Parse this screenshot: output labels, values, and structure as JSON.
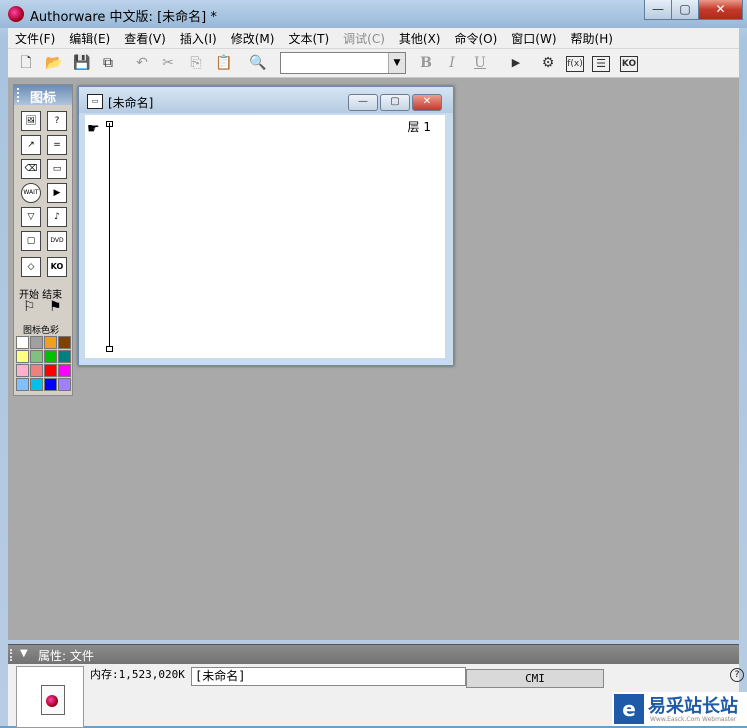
{
  "window": {
    "title": "Authorware 中文版: [未命名] *",
    "min": "—",
    "max": "▢",
    "close": "✕"
  },
  "menu": [
    "文件(F)",
    "编辑(E)",
    "查看(V)",
    "插入(I)",
    "修改(M)",
    "文本(T)",
    "调试(C)",
    "其他(X)",
    "命令(O)",
    "窗口(W)",
    "帮助(H)"
  ],
  "menu_disabled": [
    "调试(C)"
  ],
  "toolbar": {
    "new": "🗋",
    "open": "📂",
    "save_all": "💾",
    "import": "⧉",
    "undo": "↶",
    "cut": "✂",
    "copy": "⎘",
    "paste": "📋",
    "find": "🔍",
    "style_value": "",
    "bold": "B",
    "italic": "I",
    "underline": "U",
    "run": "▶",
    "control_panel": "⚙",
    "function": "f(x)",
    "variable": "☰",
    "knowledge": "KO"
  },
  "palette": {
    "title": "图标",
    "start_end": "开始 结束",
    "icon_color_label": "图标色彩",
    "icons": [
      "显示",
      "交互",
      "移动",
      "计算",
      "擦除",
      "群组",
      "等待",
      "数字电影",
      "导航",
      "声音",
      "框架",
      "DVD",
      "判断",
      "知识对象"
    ],
    "icon_glyphs": [
      "🖼",
      "?",
      "↗",
      "=",
      "⌫",
      "▭",
      "WAIT",
      "▶",
      "▽",
      "♪",
      "▢",
      "DVD",
      "◇",
      "KO"
    ],
    "start_flag": "⚐",
    "end_flag": "⚑",
    "colors": [
      "#ffffff",
      "#a0a0a0",
      "#f0a020",
      "#804000",
      "#ffff80",
      "#80c080",
      "#00c000",
      "#008080",
      "#ffb0d0",
      "#f08080",
      "#ff0000",
      "#ff00ff",
      "#80c0ff",
      "#00c0f0",
      "#0000ff",
      "#a080ff"
    ]
  },
  "flow": {
    "title": "[未命名]",
    "layer": "层 1",
    "hand": "☛",
    "min": "—",
    "max": "▢",
    "close": "✕"
  },
  "props": {
    "title": "属性: 文件",
    "memory": "内存:1,523,020K",
    "file_name": "[未命名]",
    "tab": "CMI",
    "help": "?"
  },
  "watermark": {
    "text": "易采站长站",
    "sub": "Www.Easck.Com Webmaster",
    "logo": "e"
  }
}
